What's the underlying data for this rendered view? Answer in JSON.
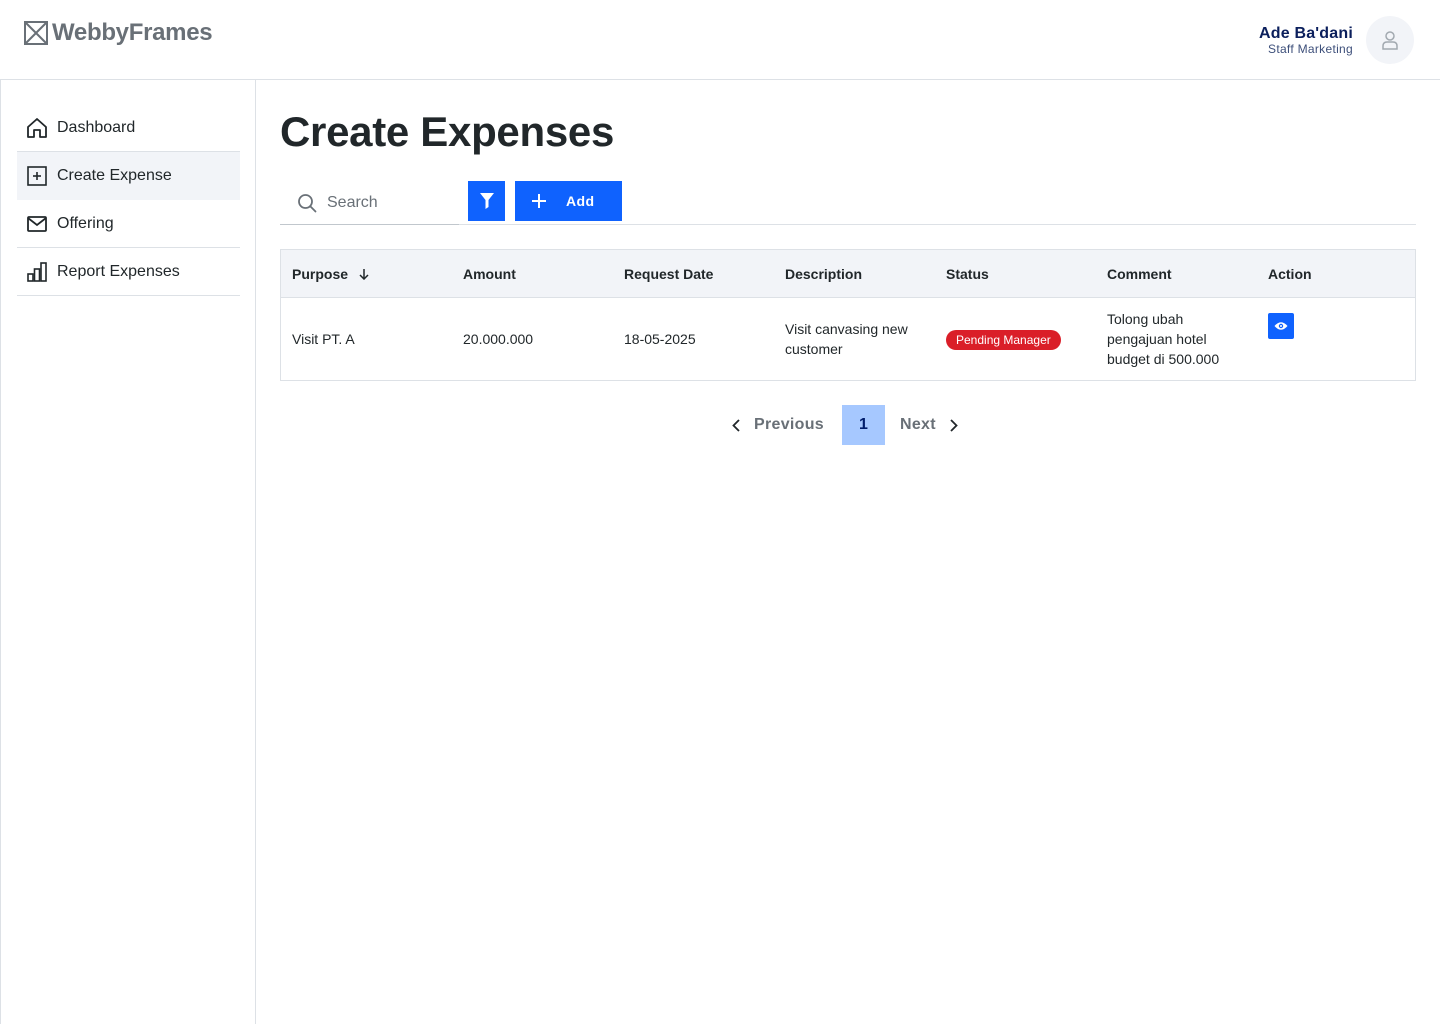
{
  "app": {
    "name": "WebbyFrames"
  },
  "user": {
    "name": "Ade Ba'dani",
    "role": "Staff Marketing"
  },
  "sidebar": {
    "items": [
      {
        "label": "Dashboard",
        "icon": "home-icon",
        "active": false
      },
      {
        "label": "Create Expense",
        "icon": "plus-square-icon",
        "active": true
      },
      {
        "label": "Offering",
        "icon": "envelope-icon",
        "active": false
      },
      {
        "label": "Report Expenses",
        "icon": "bar-chart-icon",
        "active": false
      }
    ]
  },
  "page": {
    "title": "Create Expenses"
  },
  "toolbar": {
    "search_placeholder": "Search",
    "add_label": "Add"
  },
  "table": {
    "columns": [
      "Purpose",
      "Amount",
      "Request Date",
      "Description",
      "Status",
      "Comment",
      "Action"
    ],
    "sorted_column": "Purpose",
    "rows": [
      {
        "purpose": "Visit PT. A",
        "amount": "20.000.000",
        "request_date": "18-05-2025",
        "description": "Visit canvasing new customer",
        "status": "Pending Manager",
        "comment": "Tolong ubah pengajuan hotel budget di 500.000"
      }
    ]
  },
  "pagination": {
    "previous": "Previous",
    "current": "1",
    "next": "Next"
  },
  "colors": {
    "primary": "#0f62fe",
    "danger": "#da1e28",
    "page_active": "#a6c8ff"
  }
}
